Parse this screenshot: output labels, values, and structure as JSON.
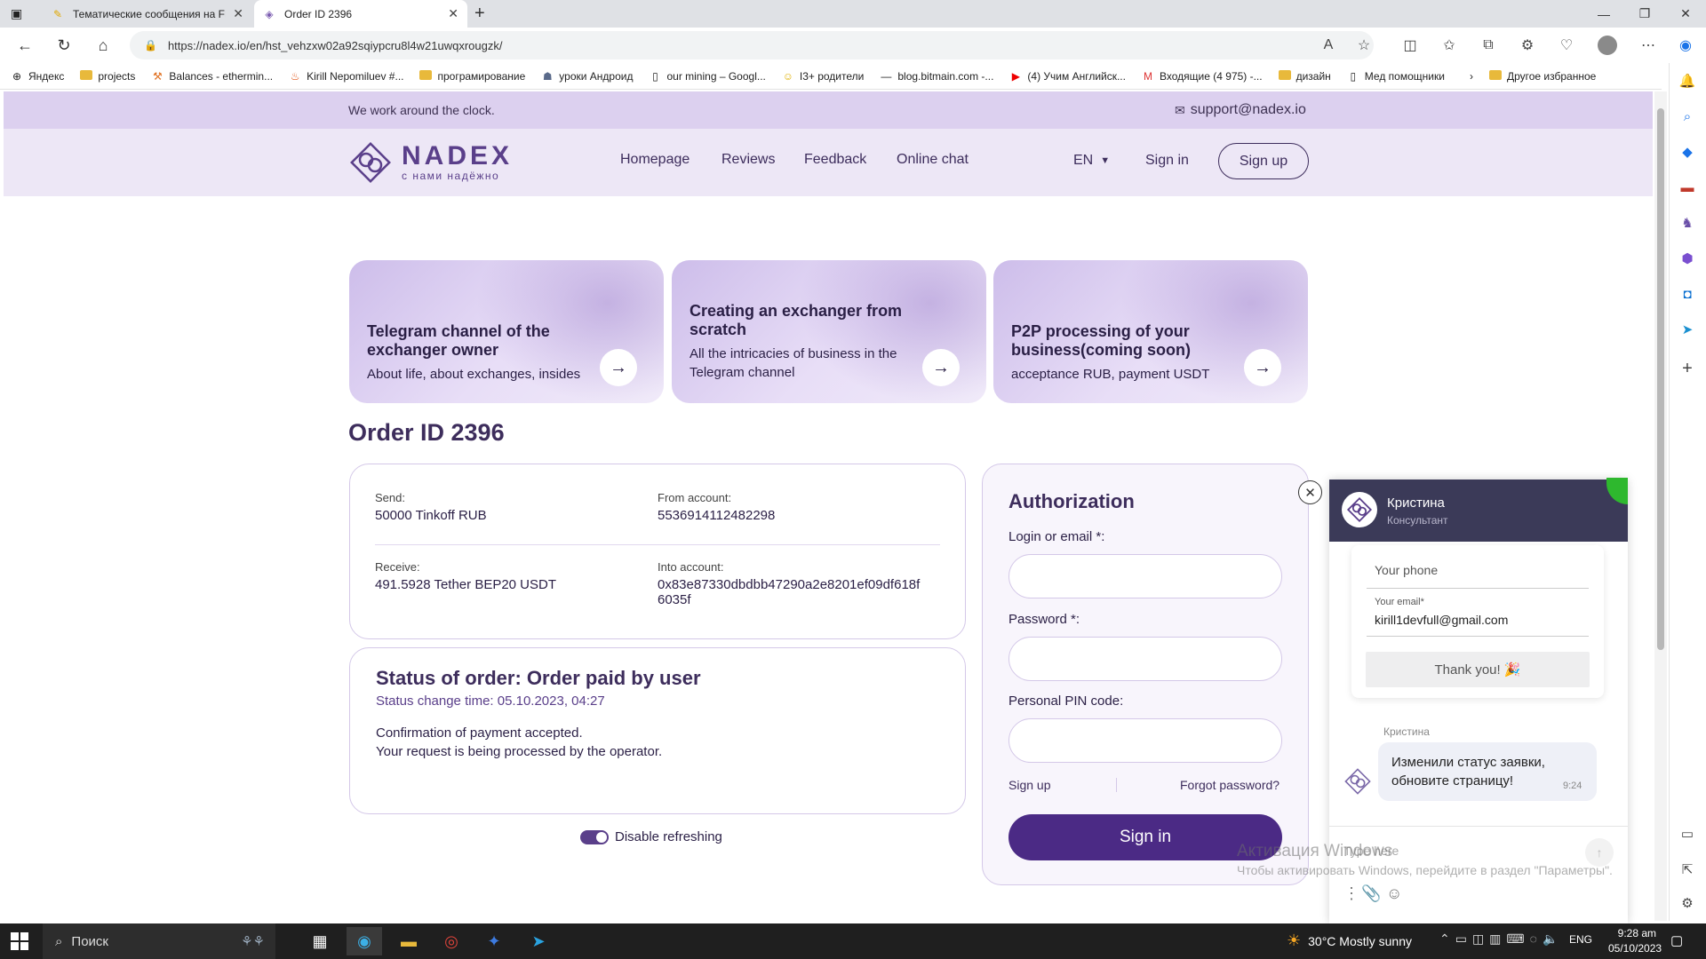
{
  "browser": {
    "tabs": [
      {
        "title": "Тематические сообщения на FL",
        "icon": "fl-icon"
      },
      {
        "title": "Order ID 2396",
        "icon": "nadex-icon"
      }
    ],
    "url": "https://nadex.io/en/hst_vehzxw02a92sqiypcru8l4w21uwqxrougzk/",
    "bookmarks": [
      {
        "label": "Яндекс"
      },
      {
        "label": "projects"
      },
      {
        "label": "Balances - ethermin..."
      },
      {
        "label": "Kirill Nepomiluev #..."
      },
      {
        "label": "програмирование"
      },
      {
        "label": "уроки Андроид"
      },
      {
        "label": "our mining – Googl..."
      },
      {
        "label": "I3+ родители"
      },
      {
        "label": "blog.bitmain.com -..."
      },
      {
        "label": "(4) Учим Английск..."
      },
      {
        "label": "Входящие (4 975) -..."
      },
      {
        "label": "дизайн"
      },
      {
        "label": "Мед помощники"
      }
    ],
    "bookmarks_other": "Другое избранное"
  },
  "site": {
    "topbar_text": "We work around the clock.",
    "support_email": "support@nadex.io",
    "logo_name": "NADEX",
    "logo_tagline": "с нами надёжно",
    "nav": [
      "Homepage",
      "Reviews",
      "Feedback",
      "Online chat"
    ],
    "lang": "EN",
    "signin": "Sign in",
    "signup": "Sign up",
    "cards": [
      {
        "title": "Telegram channel of the exchanger owner",
        "subtitle": "About life, about exchanges, insides"
      },
      {
        "title": "Creating an exchanger from scratch",
        "subtitle": "All the intricacies of business in the Telegram channel"
      },
      {
        "title": "P2P processing of your business(coming soon)",
        "subtitle": "acceptance RUB, payment USDT"
      }
    ]
  },
  "order": {
    "title": "Order ID 2396",
    "send_label": "Send:",
    "send_value": "50000 Tinkoff RUB",
    "from_label": "From account:",
    "from_value": "5536914112482298",
    "receive_label": "Receive:",
    "receive_value": "491.5928 Tether BEP20 USDT",
    "into_label": "Into account:",
    "into_value_1": "0x83e87330dbdbb47290a2e8201ef09df618f",
    "into_value_2": "6035f",
    "status_title": "Status of order: Order paid by user",
    "status_time": "Status change time: 05.10.2023, 04:27",
    "status_line1": "Confirmation of payment accepted.",
    "status_line2": "Your request is being processed by the operator.",
    "refresh_label": "Disable refreshing"
  },
  "auth": {
    "title": "Authorization",
    "login_label": "Login or email *:",
    "password_label": "Password *:",
    "pin_label": "Personal PIN code:",
    "signup": "Sign up",
    "forgot": "Forgot password?",
    "signin_button": "Sign in"
  },
  "chat": {
    "agent_name": "Кристина",
    "agent_role": "Консультант",
    "phone_placeholder": "Your phone",
    "email_label": "Your email*",
    "email_value": "kirill1devfull@gmail.com",
    "thanks": "Thank you! 🎉",
    "msg_author": "Кристина",
    "msg_text": "Изменили статус заявки, обновите страницу!",
    "msg_time": "9:24",
    "input_placeholder": "Type here"
  },
  "watermark": {
    "line1": "Активация Windows",
    "line2": "Чтобы активировать Windows, перейдите в раздел \"Параметры\"."
  },
  "taskbar": {
    "search": "Поиск",
    "weather": "30°C  Mostly sunny",
    "lang": "ENG",
    "time": "9:28 am",
    "date": "05/10/2023"
  }
}
